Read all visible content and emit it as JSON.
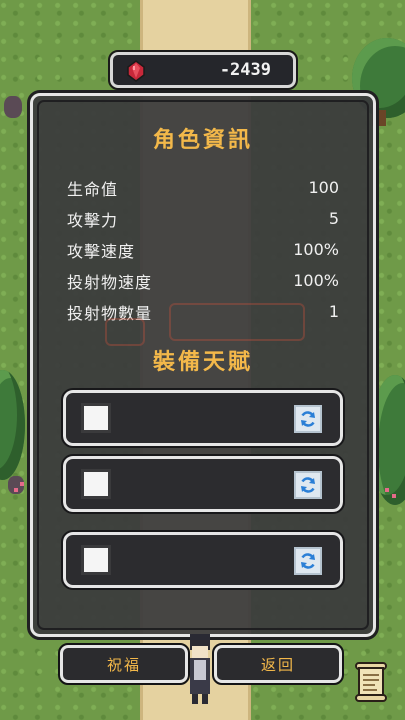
{
  "currency": {
    "value": "-2439",
    "icon": "red-gem-icon"
  },
  "panel": {
    "title": "角色資訊",
    "stats": [
      {
        "label": "生命值",
        "value": "100"
      },
      {
        "label": "攻擊力",
        "value": "5"
      },
      {
        "label": "攻擊速度",
        "value": "100%"
      },
      {
        "label": "投射物速度",
        "value": "100%"
      },
      {
        "label": "投射物數量",
        "value": "1"
      }
    ],
    "talent_title": "裝備天賦",
    "slots": [
      {
        "icon": "refresh-icon"
      },
      {
        "icon": "refresh-icon"
      },
      {
        "icon": "refresh-icon"
      }
    ]
  },
  "buttons": {
    "bless": "祝福",
    "back": "返回"
  },
  "colors": {
    "accent": "#f3b84a",
    "panel": "#3a3a3c",
    "border": "#e6e6e6",
    "gem": "#c8283a"
  }
}
